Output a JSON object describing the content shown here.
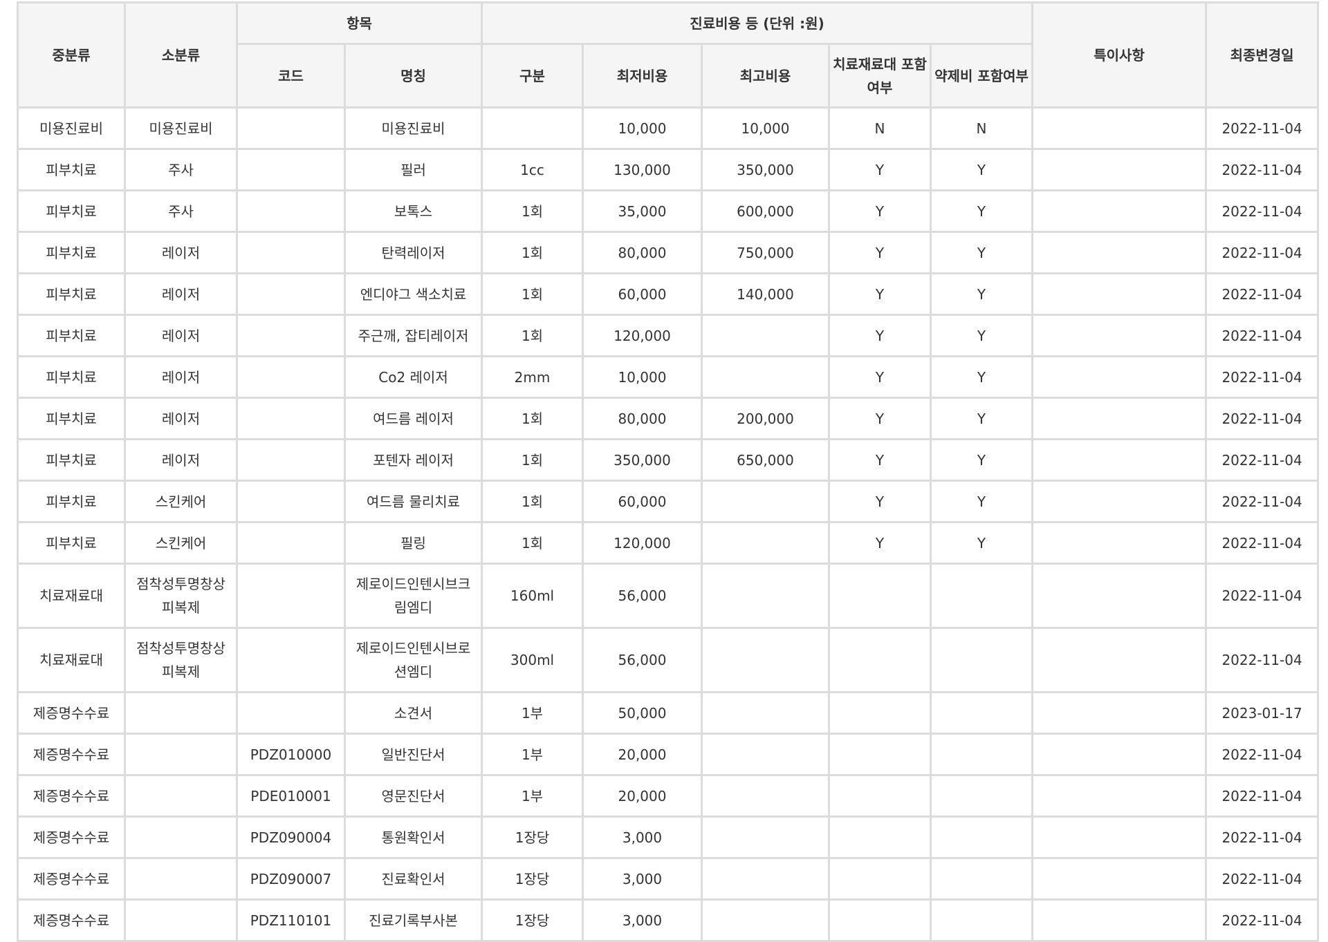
{
  "table": {
    "headers": {
      "mid_category": "중분류",
      "sub_category": "소분류",
      "item_group": "항목",
      "cost_group": "진료비용 등 (단위 :원)",
      "remarks": "특이사항",
      "last_modified": "최종변경일",
      "code": "코드",
      "name": "명칭",
      "unit": "구분",
      "min_cost": "최저비용",
      "max_cost": "최고비용",
      "material_line1": "치료재료대",
      "material_line2": "포함여부",
      "drug_line1": "약제비",
      "drug_line2": "포함여부"
    },
    "rows": [
      {
        "mid": "미용진료비",
        "sub": "미용진료비",
        "code": "",
        "name": "미용진료비",
        "unit": "",
        "min": "10,000",
        "max": "10,000",
        "material": "N",
        "drug": "N",
        "remark": "",
        "date": "2022-11-04"
      },
      {
        "mid": "피부치료",
        "sub": "주사",
        "code": "",
        "name": "필러",
        "unit": "1cc",
        "min": "130,000",
        "max": "350,000",
        "material": "Y",
        "drug": "Y",
        "remark": "",
        "date": "2022-11-04"
      },
      {
        "mid": "피부치료",
        "sub": "주사",
        "code": "",
        "name": "보톡스",
        "unit": "1회",
        "min": "35,000",
        "max": "600,000",
        "material": "Y",
        "drug": "Y",
        "remark": "",
        "date": "2022-11-04"
      },
      {
        "mid": "피부치료",
        "sub": "레이저",
        "code": "",
        "name": "탄력레이저",
        "unit": "1회",
        "min": "80,000",
        "max": "750,000",
        "material": "Y",
        "drug": "Y",
        "remark": "",
        "date": "2022-11-04"
      },
      {
        "mid": "피부치료",
        "sub": "레이저",
        "code": "",
        "name": "엔디야그 색소치료",
        "unit": "1회",
        "min": "60,000",
        "max": "140,000",
        "material": "Y",
        "drug": "Y",
        "remark": "",
        "date": "2022-11-04"
      },
      {
        "mid": "피부치료",
        "sub": "레이저",
        "code": "",
        "name": "주근깨, 잡티레이저",
        "unit": "1회",
        "min": "120,000",
        "max": "",
        "material": "Y",
        "drug": "Y",
        "remark": "",
        "date": "2022-11-04"
      },
      {
        "mid": "피부치료",
        "sub": "레이저",
        "code": "",
        "name": "Co2 레이저",
        "unit": "2mm",
        "min": "10,000",
        "max": "",
        "material": "Y",
        "drug": "Y",
        "remark": "",
        "date": "2022-11-04"
      },
      {
        "mid": "피부치료",
        "sub": "레이저",
        "code": "",
        "name": "여드름 레이저",
        "unit": "1회",
        "min": "80,000",
        "max": "200,000",
        "material": "Y",
        "drug": "Y",
        "remark": "",
        "date": "2022-11-04"
      },
      {
        "mid": "피부치료",
        "sub": "레이저",
        "code": "",
        "name": "포텐자 레이저",
        "unit": "1회",
        "min": "350,000",
        "max": "650,000",
        "material": "Y",
        "drug": "Y",
        "remark": "",
        "date": "2022-11-04"
      },
      {
        "mid": "피부치료",
        "sub": "스킨케어",
        "code": "",
        "name": "여드름 물리치료",
        "unit": "1회",
        "min": "60,000",
        "max": "",
        "material": "Y",
        "drug": "Y",
        "remark": "",
        "date": "2022-11-04"
      },
      {
        "mid": "피부치료",
        "sub": "스킨케어",
        "code": "",
        "name": "필링",
        "unit": "1회",
        "min": "120,000",
        "max": "",
        "material": "Y",
        "drug": "Y",
        "remark": "",
        "date": "2022-11-04"
      },
      {
        "mid": "치료재료대",
        "sub": "점착성투명창상\n피복제",
        "code": "",
        "name": "제로이드인텐시브크\n림엠디",
        "unit": "160ml",
        "min": "56,000",
        "max": "",
        "material": "",
        "drug": "",
        "remark": "",
        "date": "2022-11-04"
      },
      {
        "mid": "치료재료대",
        "sub": "점착성투명창상\n피복제",
        "code": "",
        "name": "제로이드인텐시브로\n션엠디",
        "unit": "300ml",
        "min": "56,000",
        "max": "",
        "material": "",
        "drug": "",
        "remark": "",
        "date": "2022-11-04"
      },
      {
        "mid": "제증명수수료",
        "sub": "",
        "code": "",
        "name": "소견서",
        "unit": "1부",
        "min": "50,000",
        "max": "",
        "material": "",
        "drug": "",
        "remark": "",
        "date": "2023-01-17"
      },
      {
        "mid": "제증명수수료",
        "sub": "",
        "code": "PDZ010000",
        "name": "일반진단서",
        "unit": "1부",
        "min": "20,000",
        "max": "",
        "material": "",
        "drug": "",
        "remark": "",
        "date": "2022-11-04"
      },
      {
        "mid": "제증명수수료",
        "sub": "",
        "code": "PDE010001",
        "name": "영문진단서",
        "unit": "1부",
        "min": "20,000",
        "max": "",
        "material": "",
        "drug": "",
        "remark": "",
        "date": "2022-11-04"
      },
      {
        "mid": "제증명수수료",
        "sub": "",
        "code": "PDZ090004",
        "name": "통원확인서",
        "unit": "1장당",
        "min": "3,000",
        "max": "",
        "material": "",
        "drug": "",
        "remark": "",
        "date": "2022-11-04"
      },
      {
        "mid": "제증명수수료",
        "sub": "",
        "code": "PDZ090007",
        "name": "진료확인서",
        "unit": "1장당",
        "min": "3,000",
        "max": "",
        "material": "",
        "drug": "",
        "remark": "",
        "date": "2022-11-04"
      },
      {
        "mid": "제증명수수료",
        "sub": "",
        "code": "PDZ110101",
        "name": "진료기록부사본",
        "unit": "1장당",
        "min": "3,000",
        "max": "",
        "material": "",
        "drug": "",
        "remark": "",
        "date": "2022-11-04"
      }
    ]
  }
}
